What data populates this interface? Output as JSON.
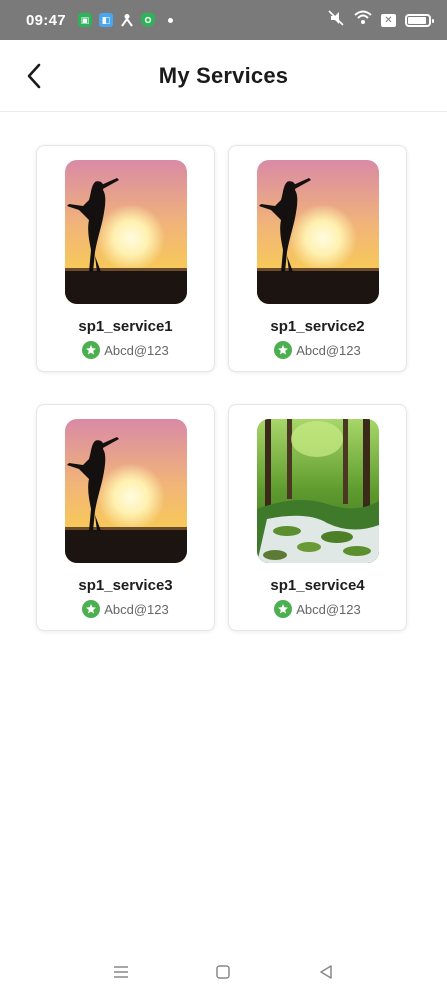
{
  "status_bar": {
    "time": "09:47",
    "left_icons": [
      "notification-app-icon",
      "blue-app-icon",
      "person-icon",
      "shield-icon"
    ],
    "right_icons": [
      "mute-icon",
      "wifi-icon",
      "x-box-icon",
      "battery-icon"
    ],
    "battery_level": 0.9
  },
  "header": {
    "title": "My Services",
    "back_icon": "chevron-left-icon"
  },
  "services": [
    {
      "name": "sp1_service1",
      "user": "Abcd@123",
      "image": "sunset-silhouette"
    },
    {
      "name": "sp1_service2",
      "user": "Abcd@123",
      "image": "sunset-silhouette"
    },
    {
      "name": "sp1_service3",
      "user": "Abcd@123",
      "image": "sunset-silhouette"
    },
    {
      "name": "sp1_service4",
      "user": "Abcd@123",
      "image": "forest-stream"
    }
  ],
  "colors": {
    "badge": "#4caf50",
    "status_bar": "#7a7a7a"
  },
  "nav": {
    "icons": [
      "menu-icon",
      "home-square-icon",
      "back-triangle-icon"
    ]
  }
}
